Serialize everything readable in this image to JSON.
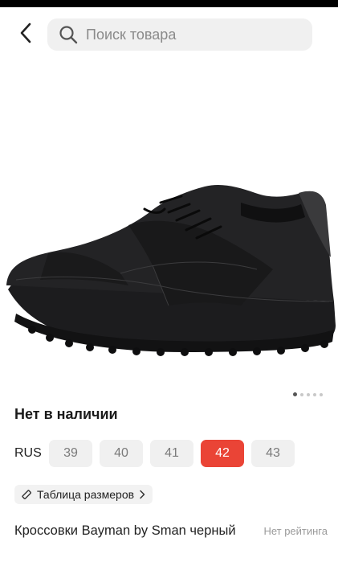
{
  "search": {
    "placeholder": "Поиск товара"
  },
  "gallery": {
    "image_alt": "black leather sneaker",
    "slide_count": 5,
    "active_slide": 1
  },
  "availability": "Нет в наличии",
  "sizes": {
    "system": "RUS",
    "options": [
      "39",
      "40",
      "41",
      "42",
      "43"
    ],
    "selected": "42"
  },
  "size_table_label": "Таблица размеров",
  "product": {
    "title": "Кроссовки Bayman by Sman черный",
    "rating_text": "Нет рейтинга"
  },
  "colors": {
    "accent": "#ea4436",
    "chip_bg": "#f0f0f0"
  },
  "icons": {
    "back": "chevron-left-icon",
    "search": "search-icon",
    "size_table": "ruler-icon",
    "chevron": "chevron-right-icon"
  }
}
